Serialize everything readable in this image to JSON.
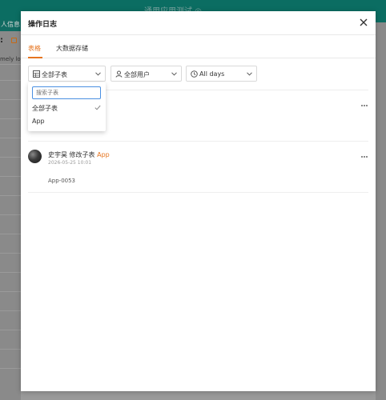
{
  "background": {
    "app_title": "通用应用测试 ◎",
    "tab_fragment": "人信息",
    "colon": ":",
    "cut_text": "mely lo"
  },
  "modal": {
    "title": "操作日志",
    "close_icon": "close-icon"
  },
  "tabs": [
    {
      "label": "表格",
      "active": true
    },
    {
      "label": "大数据存储",
      "active": false
    }
  ],
  "filters": {
    "table": {
      "label": "全部子表",
      "icon": "table-icon"
    },
    "user": {
      "label": "全部用户",
      "icon": "user-icon"
    },
    "time": {
      "label": "All days",
      "icon": "clock-icon"
    }
  },
  "dropdown": {
    "search_placeholder": "搜索子表",
    "options": [
      {
        "label": "全部子表",
        "selected": true
      },
      {
        "label": "App",
        "selected": false
      }
    ]
  },
  "entries": [
    {
      "user": "史宇昊",
      "action": "修改子表",
      "target": "App",
      "time": "2026-05-25 10:01",
      "record": "App-0053"
    }
  ],
  "colors": {
    "accent": "#e6741f",
    "header_bg": "#0b6d62",
    "focus": "#4a90e2"
  }
}
